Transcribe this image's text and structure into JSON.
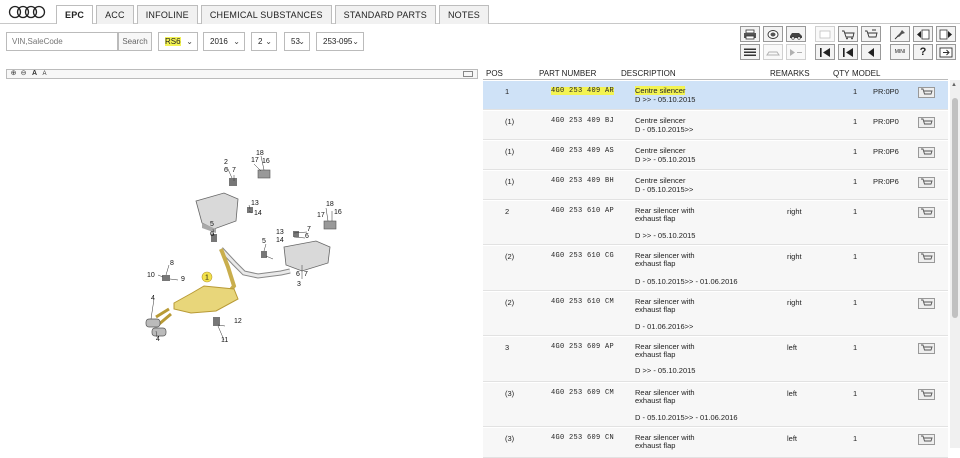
{
  "tabs": [
    "EPC",
    "ACC",
    "INFOLINE",
    "CHEMICAL SUBSTANCES",
    "STANDARD PARTS",
    "NOTES"
  ],
  "filters": {
    "vin_placeholder": "VIN,SaleCode",
    "search_label": "Search",
    "model": "RS6",
    "year": "2016",
    "main_group": "2",
    "sub_group": "53",
    "illustration": "253-095"
  },
  "toolbar": {
    "icons": [
      "printer-icon",
      "coin-icon",
      "car-icon",
      "elan-icon",
      "cart-add-icon",
      "cart-remove-icon",
      "pin-icon",
      "book-back-icon",
      "book-forward-icon",
      "list-icon",
      "car-scale-icon",
      "arrow-line-icon",
      "first-page-icon",
      "previous-page-icon",
      "back-icon",
      "mini-icon",
      "help-icon",
      "export-icon"
    ],
    "mini_label": "MINI",
    "help_label": "?"
  },
  "zoom": {
    "text_large": "A",
    "text_small": "A"
  },
  "table": {
    "headers": {
      "pos": "POS",
      "part": "PART NUMBER",
      "desc": "DESCRIPTION",
      "remarks": "REMARKS",
      "qty": "QTY",
      "model": "MODEL"
    },
    "rows": [
      {
        "pos": "1",
        "part": "4G0 253 409 AR",
        "desc1": "Centre silencer",
        "desc2": "D          >> - 05.10.2015",
        "remarks": "",
        "qty": "1",
        "model": "PR:0P0"
      },
      {
        "pos": "(1)",
        "part": "4G0 253 409 BJ",
        "desc1": "Centre silencer",
        "desc2": "D - 05.10.2015>>",
        "remarks": "",
        "qty": "1",
        "model": "PR:0P0"
      },
      {
        "pos": "(1)",
        "part": "4G0 253 409 AS",
        "desc1": "Centre silencer",
        "desc2": "D          >> - 05.10.2015",
        "remarks": "",
        "qty": "1",
        "model": "PR:0P6"
      },
      {
        "pos": "(1)",
        "part": "4G0 253 409 BH",
        "desc1": "Centre silencer",
        "desc2": "D - 05.10.2015>>",
        "remarks": "",
        "qty": "1",
        "model": "PR:0P6"
      },
      {
        "pos": "2",
        "part": "4G0 253 610 AP",
        "desc1": "Rear silencer with",
        "desc2": "exhaust flap",
        "desc3": "D          >> - 05.10.2015",
        "remarks": "right",
        "qty": "1",
        "model": ""
      },
      {
        "pos": "(2)",
        "part": "4G0 253 610 CG",
        "desc1": "Rear silencer with",
        "desc2": "exhaust flap",
        "desc3": "D - 05.10.2015>> - 01.06.2016",
        "remarks": "right",
        "qty": "1",
        "model": ""
      },
      {
        "pos": "(2)",
        "part": "4G0 253 610 CM",
        "desc1": "Rear silencer with",
        "desc2": "exhaust flap",
        "desc3": "D - 01.06.2016>>",
        "remarks": "right",
        "qty": "1",
        "model": ""
      },
      {
        "pos": "3",
        "part": "4G0 253 609 AP",
        "desc1": "Rear silencer with",
        "desc2": "exhaust flap",
        "desc3": "D          >> - 05.10.2015",
        "remarks": "left",
        "qty": "1",
        "model": ""
      },
      {
        "pos": "(3)",
        "part": "4G0 253 609 CM",
        "desc1": "Rear silencer with",
        "desc2": "exhaust flap",
        "desc3": "D - 05.10.2015>> - 01.06.2016",
        "remarks": "left",
        "qty": "1",
        "model": ""
      },
      {
        "pos": "(3)",
        "part": "4G0 253 609 CN",
        "desc1": "Rear silencer with",
        "desc2": "exhaust flap",
        "desc3": "",
        "remarks": "left",
        "qty": "1",
        "model": ""
      }
    ]
  },
  "diagram": {
    "callouts": [
      "1",
      "2",
      "3",
      "4",
      "4",
      "5",
      "5",
      "6",
      "6",
      "7",
      "7",
      "8",
      "9",
      "10",
      "11",
      "12",
      "13",
      "13",
      "14",
      "14",
      "16",
      "16",
      "17",
      "17",
      "18",
      "18"
    ]
  },
  "colors": {
    "selected_row": "#cfe2f7",
    "highlight": "#f3f352",
    "silencer_highlight": "#e8d67a"
  }
}
